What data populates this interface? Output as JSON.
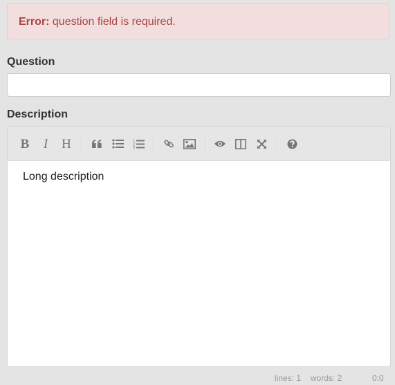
{
  "alert": {
    "prefix": "Error:",
    "message": " question field is required."
  },
  "question": {
    "label": "Question",
    "value": ""
  },
  "description": {
    "label": "Description",
    "content": "Long description"
  },
  "toolbar": {
    "icons": [
      "bold-icon",
      "italic-icon",
      "heading-icon",
      "quote-icon",
      "unordered-list-icon",
      "ordered-list-icon",
      "link-icon",
      "image-icon",
      "preview-icon",
      "side-by-side-icon",
      "fullscreen-icon",
      "help-icon"
    ],
    "bold_glyph": "B",
    "italic_glyph": "I",
    "heading_glyph": "H"
  },
  "statusbar": {
    "lines": "lines: 1",
    "words": "words: 2",
    "cursor": "0:0"
  },
  "colors": {
    "alert_bg": "#f2dede",
    "alert_text": "#a94442",
    "toolbar_icon": "#777777"
  }
}
